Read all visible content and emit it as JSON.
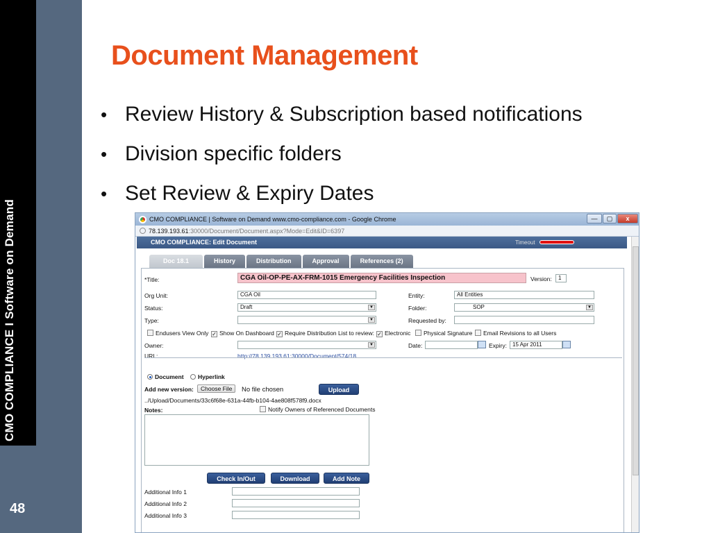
{
  "sidebar": {
    "vertical_text": "CMO COMPLIANCE I Software on Demand",
    "page_number": "48"
  },
  "slide": {
    "title": "Document Management",
    "bullets": [
      "Review History & Subscription based notifications",
      "Division specific folders",
      "Set Review & Expiry Dates"
    ]
  },
  "browser": {
    "window_title": "CMO COMPLIANCE | Software on Demand    www.cmo-compliance.com - Google Chrome",
    "url_host": "78.139.193.61",
    "url_path": ":30000/Document/Document.aspx?Mode=Edit&ID=6397",
    "minimize": "—",
    "maximize": "▢",
    "close": "x"
  },
  "app": {
    "header_title": "CMO COMPLIANCE: Edit Document",
    "timeout_label": "Timeout",
    "tabs": [
      "Doc 18.1",
      "History",
      "Distribution",
      "Approval",
      "References (2)"
    ],
    "form": {
      "title_label": "*Title:",
      "title_value": "CGA Oil-OP-PE-AX-FRM-1015 Emergency Facilities Inspection",
      "version_label": "Version:",
      "version_value": "1",
      "org_unit_label": "Org Unit:",
      "org_unit_value": "CGA Oil",
      "entity_label": "Entity:",
      "entity_value": "All Entities",
      "status_label": "Status:",
      "status_value": "Draft",
      "folder_label": "Folder:",
      "folder_value": "SOP",
      "type_label": "Type:",
      "type_value": "",
      "requested_by_label": "Requested by:",
      "requested_by_value": "",
      "checkboxes": [
        {
          "label": "Endusers View Only",
          "checked": false
        },
        {
          "label": "Show On Dashboard",
          "checked": true
        },
        {
          "label": "Require Distribution List to review:",
          "checked": true
        },
        {
          "label": "Electronic",
          "checked": true
        },
        {
          "label": "Physical Signature",
          "checked": false
        },
        {
          "label": "Email Revisions to all Users",
          "checked": false
        }
      ],
      "owner_label": "Owner:",
      "owner_value": "",
      "date_label": "Date:",
      "date_value": "",
      "expiry_label": "Expiry:",
      "expiry_value": "15 Apr 2011",
      "url_label": "URL:",
      "url_value": "http://78.139.193.61:30000/Document/574/18",
      "radio_document": "Document",
      "radio_hyperlink": "Hyperlink",
      "add_version_label": "Add new version:",
      "choose_file": "Choose File",
      "no_file": "No file chosen",
      "upload": "Upload",
      "file_path": "../Upload/Documents/33c6f68e-631a-44fb-b104-4ae808f578f9.docx",
      "notes_label": "Notes:",
      "notify_owners": "Notify Owners of Referenced Documents",
      "check_in_out": "Check In/Out",
      "download": "Download",
      "add_note": "Add Note",
      "additional_info_1": "Additional Info 1",
      "additional_info_2": "Additional Info 2",
      "additional_info_3": "Additional Info 3"
    }
  },
  "colors": {
    "title_orange": "#e8501c",
    "sidebar_blue": "#55687f",
    "app_header_blue": "#3b5985",
    "title_field_pink": "#f7c3cb",
    "timeout_red": "#e01010"
  }
}
